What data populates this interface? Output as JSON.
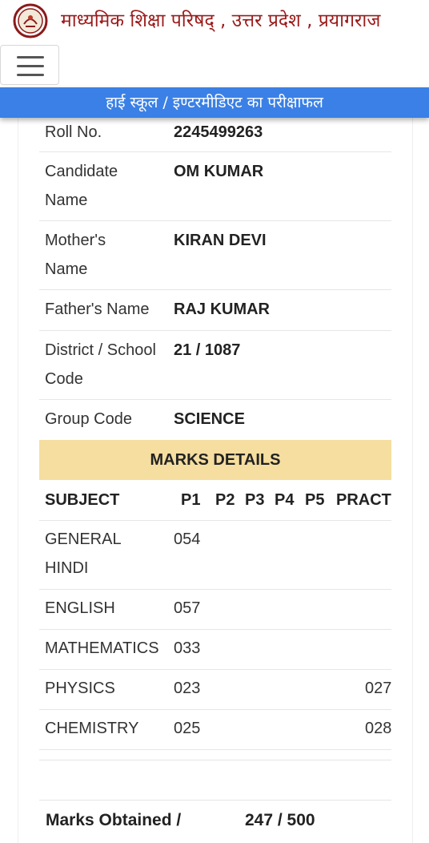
{
  "header": {
    "site_title": "माध्यमिक शिक्षा परिषद् , उत्तर प्रदेश , प्रयागराज",
    "banner": "हाई स्कूल / इण्टरमीडिएट का परीक्षाफल"
  },
  "candidate": {
    "roll_label": "Roll No.",
    "roll_value": "2245499263",
    "name_label": "Candidate Name",
    "name_value": "OM KUMAR",
    "mother_label": "Mother's Name",
    "mother_value": "KIRAN DEVI",
    "father_label": "Father's Name",
    "father_value": "RAJ KUMAR",
    "district_label": "District / School Code",
    "district_value": "21 / 1087",
    "group_label": "Group Code",
    "group_value": "SCIENCE"
  },
  "marks": {
    "heading": "MARKS DETAILS",
    "columns": [
      "SUBJECT",
      "P1",
      "P2",
      "P3",
      "P4",
      "P5",
      "PRACTI"
    ],
    "rows": [
      {
        "subject": "GENERAL HINDI",
        "p1": "054",
        "practical": ""
      },
      {
        "subject": "ENGLISH",
        "p1": "057",
        "practical": ""
      },
      {
        "subject": "MATHEMATICS",
        "p1": "033",
        "practical": ""
      },
      {
        "subject": "PHYSICS",
        "p1": "023",
        "practical": "027"
      },
      {
        "subject": "CHEMISTRY",
        "p1": "025",
        "practical": "028"
      }
    ]
  },
  "total": {
    "label": "Marks Obtained /",
    "value": "247 / 500"
  }
}
